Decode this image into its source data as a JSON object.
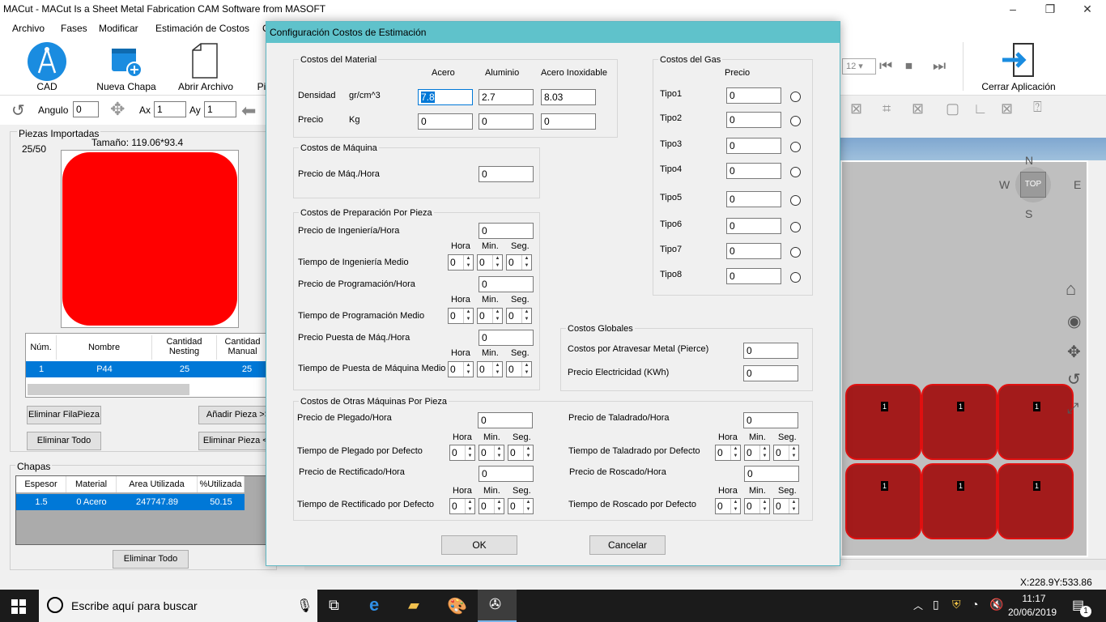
{
  "window": {
    "title": "MACut - MACut Is a Sheet Metal Fabrication CAM Software from MASOFT"
  },
  "menu": [
    "Archivo",
    "Fases",
    "Modificar",
    "Estimación de Costos",
    "C"
  ],
  "ribbon": {
    "cad": "CAD",
    "nueva_chapa": "Nueva Chapa",
    "abrir_archivo": "Abrir Archivo",
    "pi": "Pi",
    "cerrar": "Cerrar Aplicación",
    "zoom_value": "12",
    "angulo_label": "Angulo",
    "angulo_value": "0",
    "ax_label": "Ax",
    "ax_value": "1",
    "ay_label": "Ay",
    "ay_value": "1"
  },
  "piezas": {
    "title": "Piezas Importadas",
    "count": "25/50",
    "size": "Tamaño: 119.06*93.4",
    "columns": [
      "Núm.",
      "Nombre",
      "Cantidad Nesting",
      "Cantidad Manual"
    ],
    "row": [
      "1",
      "P44",
      "25",
      "25"
    ],
    "btn_eliminar_fila": "Eliminar FilaPieza",
    "btn_anadir": "Añadir Pieza >>",
    "btn_eliminar_todo": "Eliminar Todo",
    "btn_eliminar_pieza": "Eliminar Pieza <<"
  },
  "chapas": {
    "title": "Chapas",
    "columns": [
      "Espesor",
      "Material",
      "Area Utilizada",
      "%Utilizada"
    ],
    "row": [
      "1.5",
      "0  Acero",
      "247747.89",
      "50.15"
    ],
    "btn_eliminar_todo": "Eliminar Todo"
  },
  "dialog": {
    "title": "Configuración Costos de Estimación",
    "material": {
      "title": "Costos del Material",
      "col_acero": "Acero",
      "col_aluminio": "Aluminio",
      "col_inox": "Acero Inoxidable",
      "densidad": "Densidad",
      "densidad_unit": "gr/cm^3",
      "densidad_acero": "7.8",
      "densidad_aluminio": "2.7",
      "densidad_inox": "8.03",
      "precio": "Precio",
      "precio_unit": "Kg",
      "precio_acero": "0",
      "precio_aluminio": "0",
      "precio_inox": "0"
    },
    "maquina": {
      "title": "Costos de Máquina",
      "label": "Precio de Máq./Hora",
      "value": "0"
    },
    "preparacion": {
      "title": "Costos de Preparación Por Pieza",
      "ing_label": "Precio de Ingeniería/Hora",
      "ing_value": "0",
      "ing_tiempo": "Tiempo de Ingeniería Medio",
      "prog_label": "Precio de Programación/Hora",
      "prog_value": "0",
      "prog_tiempo": "Tiempo de Programación Medio",
      "puesta_label": "Precio Puesta de Máq./Hora",
      "puesta_value": "0",
      "puesta_tiempo": "Tiempo de Puesta de Máquina Medio"
    },
    "time_headers": {
      "h": "Hora",
      "m": "Min.",
      "s": "Seg."
    },
    "spin_value": "0",
    "gas": {
      "title": "Costos del Gas",
      "precio": "Precio",
      "tipos": [
        "Tipo1",
        "Tipo2",
        "Tipo3",
        "Tipo4",
        "Tipo5",
        "Tipo6",
        "Tipo7",
        "Tipo8"
      ],
      "values": [
        "0",
        "0",
        "0",
        "0",
        "0",
        "0",
        "0",
        "0"
      ]
    },
    "globales": {
      "title": "Costos Globales",
      "pierce_label": "Costos por Atravesar Metal (Pierce)",
      "pierce_value": "0",
      "elec_label": "Precio Electricidad (KWh)",
      "elec_value": "0"
    },
    "otras": {
      "title": "Costos de Otras Máquinas Por Pieza",
      "plegado_label": "Precio de Plegado/Hora",
      "plegado_value": "0",
      "plegado_tiempo": "Tiempo de Plegado por Defecto",
      "rect_label": "Precio de Rectificado/Hora",
      "rect_value": "0",
      "rect_tiempo": "Tiempo de Rectificado por Defecto",
      "tal_label": "Precio de Taladrado/Hora",
      "tal_value": "0",
      "tal_tiempo": "Tiempo de Taladrado por Defecto",
      "ros_label": "Precio de Roscado/Hora",
      "ros_value": "0",
      "ros_tiempo": "Tiempo de Roscado por Defecto"
    },
    "ok": "OK",
    "cancel": "Cancelar"
  },
  "canvas": {
    "compass": {
      "n": "N",
      "s": "S",
      "e": "E",
      "w": "W",
      "top": "TOP"
    },
    "part_label": "1",
    "coords": "X:228.9Y:533.86"
  },
  "taskbar": {
    "search": "Escribe aquí para buscar",
    "time": "11:17",
    "date": "20/06/2019",
    "notif": "1"
  }
}
